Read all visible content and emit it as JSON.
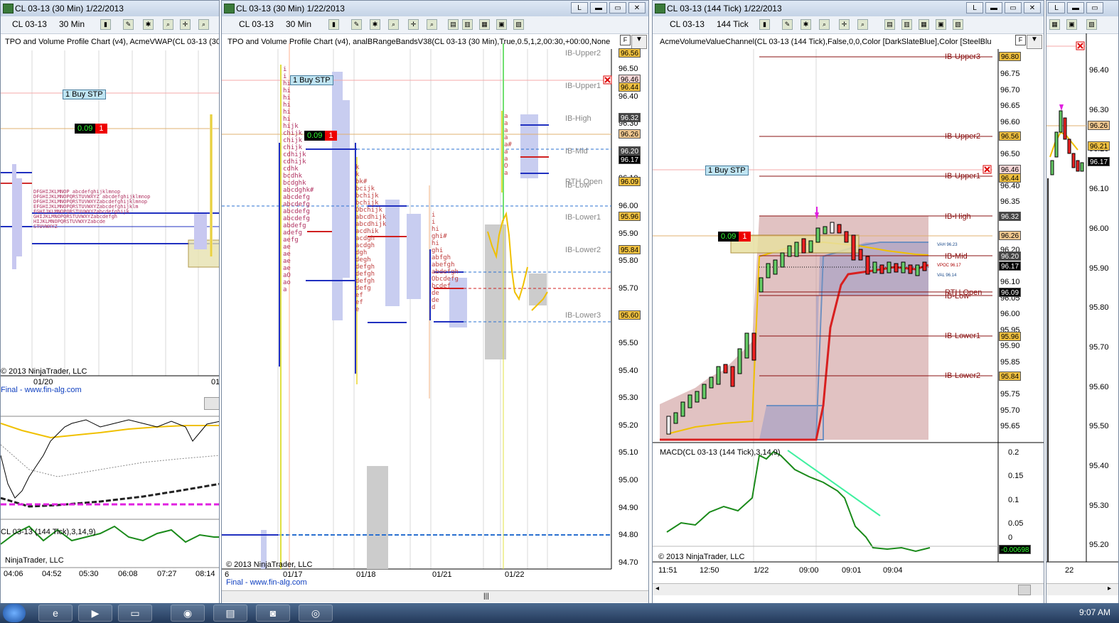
{
  "windows": {
    "left": {
      "title": "CL 03-13 (30 Min)  1/22/2013",
      "instrument": "CL 03-13",
      "period": "30 Min",
      "indicator": "TPO and Volume Profile Chart (v4), AcmeVWAP(CL 03-13 (30",
      "buy_stp": "1 Buy STP",
      "pnl_value": "0.09",
      "pnl_qty": "1",
      "copyright": "© 2013 NinjaTrader, LLC",
      "link": "Final - www.fin-alg.com",
      "date_label": "01/20",
      "date_label2": "01",
      "macd_label": "CL 03-13 (144 Tick),3,14,9)",
      "copyright2": "NinjaTrader, LLC",
      "time_labels": [
        "04:06",
        "04:52",
        "05:30",
        "06:08",
        "07:27",
        "08:14"
      ]
    },
    "mid": {
      "title": "CL 03-13 (30 Min)  1/22/2013",
      "instrument": "CL 03-13",
      "period": "30 Min",
      "indicator": "TPO and Volume Profile Chart (v4), analBRangeBandsV38(CL 03-13 (30 Min),True,0.5,1,2,00:30,+00:00,None",
      "buy_stp": "1 Buy STP",
      "pnl_value": "0.09",
      "pnl_qty": "1",
      "copyright": "© 2013 NinjaTrader, LLC",
      "link": "Final - www.fin-alg.com",
      "price_labels": [
        "96.50",
        "96.40",
        "96.30",
        "96.20",
        "96.10",
        "96.00",
        "95.90",
        "95.80",
        "95.70",
        "95.60",
        "95.50",
        "95.40",
        "95.30",
        "95.20",
        "95.10",
        "95.00",
        "94.90",
        "94.80",
        "94.70"
      ],
      "tags": [
        {
          "text": "96.56",
          "color": "#f0c040"
        },
        {
          "text": "96.46",
          "color": "#f8d8d8"
        },
        {
          "text": "96.44",
          "color": "#f0c040"
        },
        {
          "text": "96.32",
          "color": "#444444"
        },
        {
          "text": "96.26",
          "color": "#f2c890"
        },
        {
          "text": "96.20",
          "color": "#444444"
        },
        {
          "text": "96.17",
          "color": "#000000"
        },
        {
          "text": "96.09",
          "color": "#f0c040"
        },
        {
          "text": "95.96",
          "color": "#f0c040"
        },
        {
          "text": "95.84",
          "color": "#f0c040"
        },
        {
          "text": "95.60",
          "color": "#f0c040"
        }
      ],
      "ib_labels": [
        "IB-Upper2",
        "IB-Upper1",
        "IB-High",
        "IB-Mid",
        "RTH Open",
        "IB-Low",
        "IB-Lower1",
        "IB-Lower2",
        "IB-Lower3"
      ],
      "date_labels": [
        "01/17",
        "01/18",
        "01/21",
        "01/22"
      ],
      "edge_label": "6"
    },
    "right": {
      "title": "CL 03-13 (144 Tick)  1/22/2013",
      "instrument": "CL 03-13",
      "period": "144 Tick",
      "indicator": "AcmeVolumeValueChannel(CL 03-13 (144 Tick),False,0,0,Color [DarkSlateBlue],Color [SteelBlu",
      "buy_stp": "1 Buy STP",
      "pnl_value": "0.09",
      "pnl_qty": "1",
      "copyright": "© 2013 NinjaTrader, LLC",
      "price_labels": [
        "96.75",
        "96.70",
        "96.65",
        "96.60",
        "96.55",
        "96.50",
        "96.45",
        "96.40",
        "96.35",
        "96.30",
        "96.25",
        "96.20",
        "96.15",
        "96.10",
        "96.05",
        "96.00",
        "95.95",
        "95.90",
        "95.85",
        "95.80",
        "95.75",
        "95.70",
        "95.65"
      ],
      "tags": [
        {
          "text": "96.80",
          "color": "#f0c040"
        },
        {
          "text": "96.56",
          "color": "#f0c040"
        },
        {
          "text": "96.46",
          "color": "#f8d8d8"
        },
        {
          "text": "96.44",
          "color": "#f0c040"
        },
        {
          "text": "96.32",
          "color": "#444444"
        },
        {
          "text": "96.26",
          "color": "#f2c890"
        },
        {
          "text": "96.20",
          "color": "#444444"
        },
        {
          "text": "96.17",
          "color": "#000000"
        },
        {
          "text": "96.09",
          "color": "#000000"
        },
        {
          "text": "95.96",
          "color": "#f0c040"
        },
        {
          "text": "95.84",
          "color": "#f0c040"
        }
      ],
      "ib_labels": [
        "IB-Upper3",
        "IB-Upper2",
        "IB-Upper1",
        "IB-High",
        "IB-Mid",
        "RTH Open",
        "IB-Low",
        "IB-Lower1",
        "IB-Lower2"
      ],
      "vah": "VAH 96.23",
      "vpoc": "VPOC 96.17",
      "val": "VAL 96.14",
      "macd_label": "MACD(CL 03-13 (144 Tick),3,14,9)",
      "macd_axis": [
        "0.2",
        "0.15",
        "0.1",
        "0.05",
        "0"
      ],
      "macd_value": "-0.00698",
      "time_labels": [
        "11:51",
        "12:50",
        "1/22",
        "09:00",
        "09:01",
        "09:04"
      ]
    },
    "far_right": {
      "price_labels": [
        "96.40",
        "96.30",
        "96.20",
        "96.10",
        "96.00",
        "95.90",
        "95.80",
        "95.70",
        "95.60",
        "95.50",
        "95.40",
        "95.30",
        "95.20"
      ],
      "tags": [
        {
          "text": "96.26",
          "color": "#f2c890"
        },
        {
          "text": "96.21",
          "color": "#f0c040"
        },
        {
          "text": "96.17",
          "color": "#000000"
        }
      ],
      "date_label": "22"
    }
  },
  "taskbar": {
    "clock": "9:07 AM"
  }
}
